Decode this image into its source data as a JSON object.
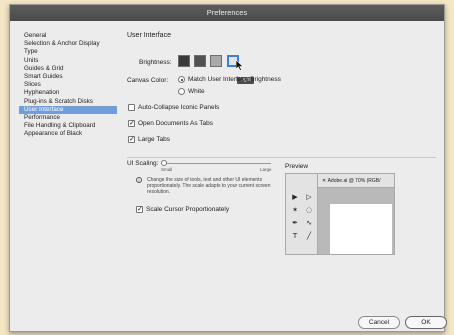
{
  "window": {
    "title": "Preferences"
  },
  "sidebar": {
    "items": [
      {
        "label": "General"
      },
      {
        "label": "Selection & Anchor Display"
      },
      {
        "label": "Type"
      },
      {
        "label": "Units"
      },
      {
        "label": "Guides & Grid"
      },
      {
        "label": "Smart Guides"
      },
      {
        "label": "Slices"
      },
      {
        "label": "Hyphenation"
      },
      {
        "label": "Plug-ins & Scratch Disks"
      },
      {
        "label": "User Interface",
        "selected": true
      },
      {
        "label": "Performance"
      },
      {
        "label": "File Handling & Clipboard"
      },
      {
        "label": "Appearance of Black"
      }
    ]
  },
  "ui": {
    "section_title": "User Interface",
    "brightness_label": "Brightness:",
    "brightness_swatches": [
      "#3a3a3a",
      "#525252",
      "#a9a9a9",
      "#e4e4e4"
    ],
    "brightness_selected": "Light",
    "tooltip": "Light",
    "canvas_color_label": "Canvas Color:",
    "canvas_option_match": "Match User Interface Brightness",
    "canvas_option_white": "White",
    "auto_collapse": "Auto-Collapse Iconic Panels",
    "open_docs_tabs": "Open Documents As Tabs",
    "large_tabs": "Large Tabs",
    "ui_scaling_label": "UI Scaling:",
    "scale_small": "Small",
    "scale_large": "Large",
    "info_text": "Change the size of tools, text and other UI elements proportionately. The scale adapts to your current screen resolution.",
    "scale_cursor": "Scale Cursor Proportionately",
    "preview_label": "Preview",
    "preview_doc_tab": "Adobe.ai @ 70% (RGB/",
    "auto_collapse_checked": false,
    "open_docs_checked": true,
    "large_tabs_checked": true,
    "scale_cursor_checked": true
  },
  "buttons": {
    "cancel": "Cancel",
    "ok": "OK"
  },
  "icons": {
    "info": "info-icon",
    "cursor": "pointer-cursor-icon"
  }
}
